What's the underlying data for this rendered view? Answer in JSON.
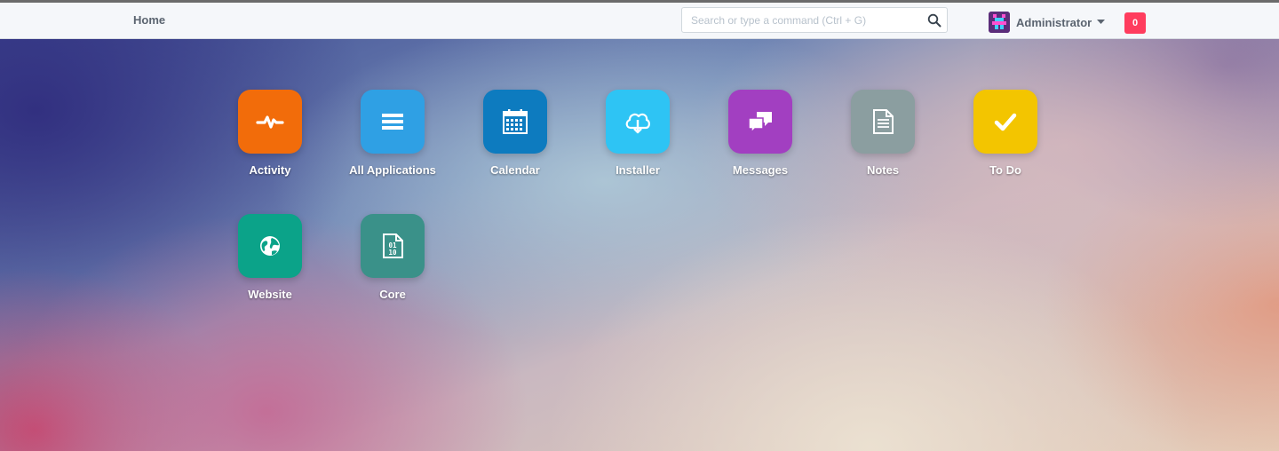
{
  "navbar": {
    "home_label": "Home",
    "search_placeholder": "Search or type a command (Ctrl + G)",
    "user_name": "Administrator",
    "notification_count": "0"
  },
  "apps": [
    {
      "label": "Activity",
      "color": "#f26c0a",
      "icon": "activity-icon"
    },
    {
      "label": "All Applications",
      "color": "#2fa0e4",
      "icon": "list-icon"
    },
    {
      "label": "Calendar",
      "color": "#0d7bbf",
      "icon": "calendar-icon"
    },
    {
      "label": "Installer",
      "color": "#2ec4f4",
      "icon": "cloud-download-icon"
    },
    {
      "label": "Messages",
      "color": "#a23fc1",
      "icon": "chat-icon"
    },
    {
      "label": "Notes",
      "color": "#8b9ea0",
      "icon": "document-icon"
    },
    {
      "label": "To Do",
      "color": "#f3c500",
      "icon": "check-icon"
    },
    {
      "label": "Website",
      "color": "#0ba389",
      "icon": "globe-icon"
    },
    {
      "label": "Core",
      "color": "#3a9189",
      "icon": "binary-file-icon"
    }
  ]
}
